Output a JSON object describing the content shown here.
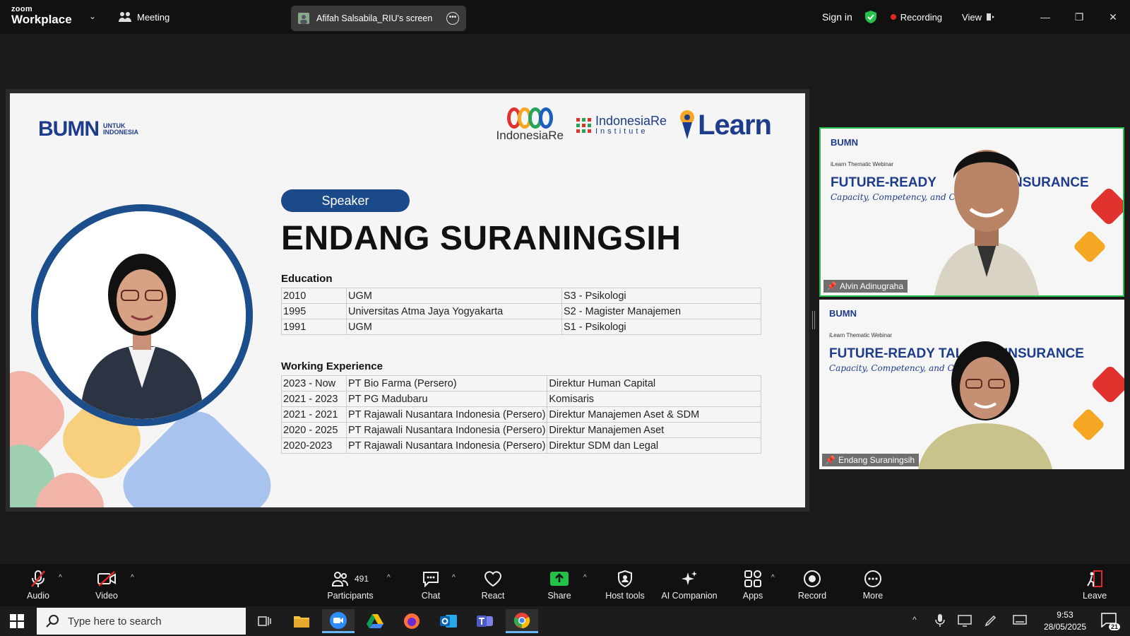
{
  "app": {
    "logo_line1": "zoom",
    "logo_line2": "Workplace",
    "meeting_label": "Meeting",
    "screen_share_label": "Afifah Salsabila_RIU's screen"
  },
  "topright": {
    "sign_in": "Sign in",
    "recording": "Recording",
    "view": "View"
  },
  "slide": {
    "bumn_logo": "BUMN",
    "bumn_tag1": "UNTUK",
    "bumn_tag2": "INDONESIA",
    "logo_indonesiare": "IndonesiaRe",
    "logo_institute_1": "IndonesiaRe",
    "logo_institute_2": "Institute",
    "logo_ilearn": "Learn",
    "speaker_label": "Speaker",
    "speaker_name": "ENDANG SURANINGSIH",
    "education_title": "Education",
    "education": [
      {
        "year": "2010",
        "school": "UGM",
        "degree": "S3 - Psikologi"
      },
      {
        "year": "1995",
        "school": "Universitas Atma Jaya Yogyakarta",
        "degree": "S2 - Magister Manajemen"
      },
      {
        "year": "1991",
        "school": "UGM",
        "degree": "S1 - Psikologi"
      }
    ],
    "experience_title": "Working Experience",
    "experience": [
      {
        "period": "2023 - Now",
        "company": "PT Bio Farma (Persero)",
        "role": "Direktur Human Capital"
      },
      {
        "period": "2021 - 2023",
        "company": "PT PG Madubaru",
        "role": "Komisaris"
      },
      {
        "period": "2021 - 2021",
        "company": "PT Rajawali Nusantara Indonesia (Persero)",
        "role": "Direktur Manajemen Aset & SDM"
      },
      {
        "period": "2020 - 2025",
        "company": "PT Rajawali Nusantara Indonesia (Persero)",
        "role": "Direktur Manajemen Aset"
      },
      {
        "period": "2020-2023",
        "company": "PT Rajawali Nusantara Indonesia (Persero)",
        "role": "Direktur SDM dan Legal"
      }
    ]
  },
  "tiles": [
    {
      "name": "Alvin Adinugraha",
      "sub": "iLearn Thematic Webinar",
      "head": "FUTURE-READY",
      "head2": "NSURANCE",
      "script": "Capacity, Competency, and Cult"
    },
    {
      "name": "Endang Suraningsih",
      "sub": "iLearn Thematic Webinar",
      "head": "FUTURE-READY TAL",
      "head2": "INSURANCE",
      "script": "Capacity, Competency, and Culture"
    }
  ],
  "toolbar": {
    "audio": "Audio",
    "video": "Video",
    "participants": "Participants",
    "participants_count": "491",
    "chat": "Chat",
    "react": "React",
    "share": "Share",
    "host_tools": "Host tools",
    "ai_companion": "AI Companion",
    "apps": "Apps",
    "record": "Record",
    "more": "More",
    "leave": "Leave"
  },
  "taskbar": {
    "search_placeholder": "Type here to search",
    "time": "9:53",
    "date": "28/05/2025",
    "notifications": "21"
  },
  "colors": {
    "accent_green": "#27c04a",
    "recording_red": "#e02828",
    "brand_blue": "#1d3c8c",
    "share_green": "#21c14a"
  }
}
